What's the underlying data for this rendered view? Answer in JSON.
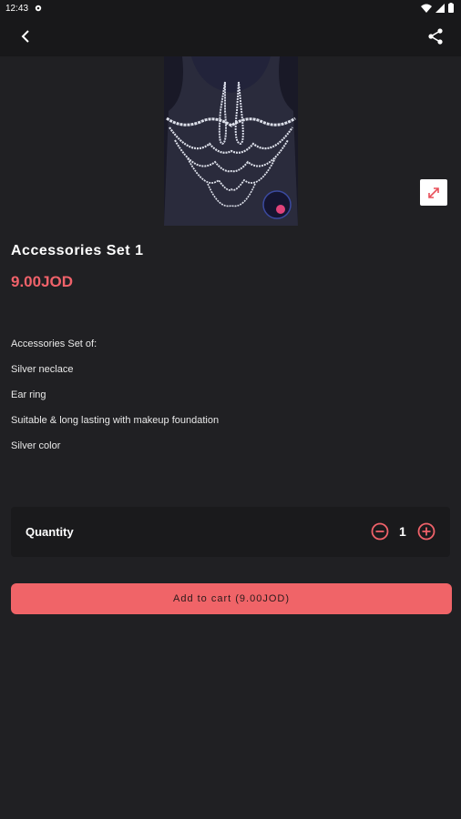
{
  "status_bar": {
    "time": "12:43"
  },
  "product": {
    "title": "Accessories Set 1",
    "price": "9.00JOD",
    "description": [
      "Accessories Set of:",
      "Silver neclace",
      "Ear ring",
      "Suitable & long lasting with makeup foundation",
      "Silver color"
    ]
  },
  "quantity": {
    "label": "Quantity",
    "value": "1"
  },
  "cart": {
    "add_label": "Add to cart (9.00JOD)"
  },
  "colors": {
    "accent": "#f0626a",
    "background": "#202023",
    "card": "#1a1a1c"
  },
  "icons": {
    "back": "arrow-left-icon",
    "share": "share-icon",
    "expand": "expand-icon",
    "minus": "minus-circle-icon",
    "plus": "plus-circle-icon"
  }
}
